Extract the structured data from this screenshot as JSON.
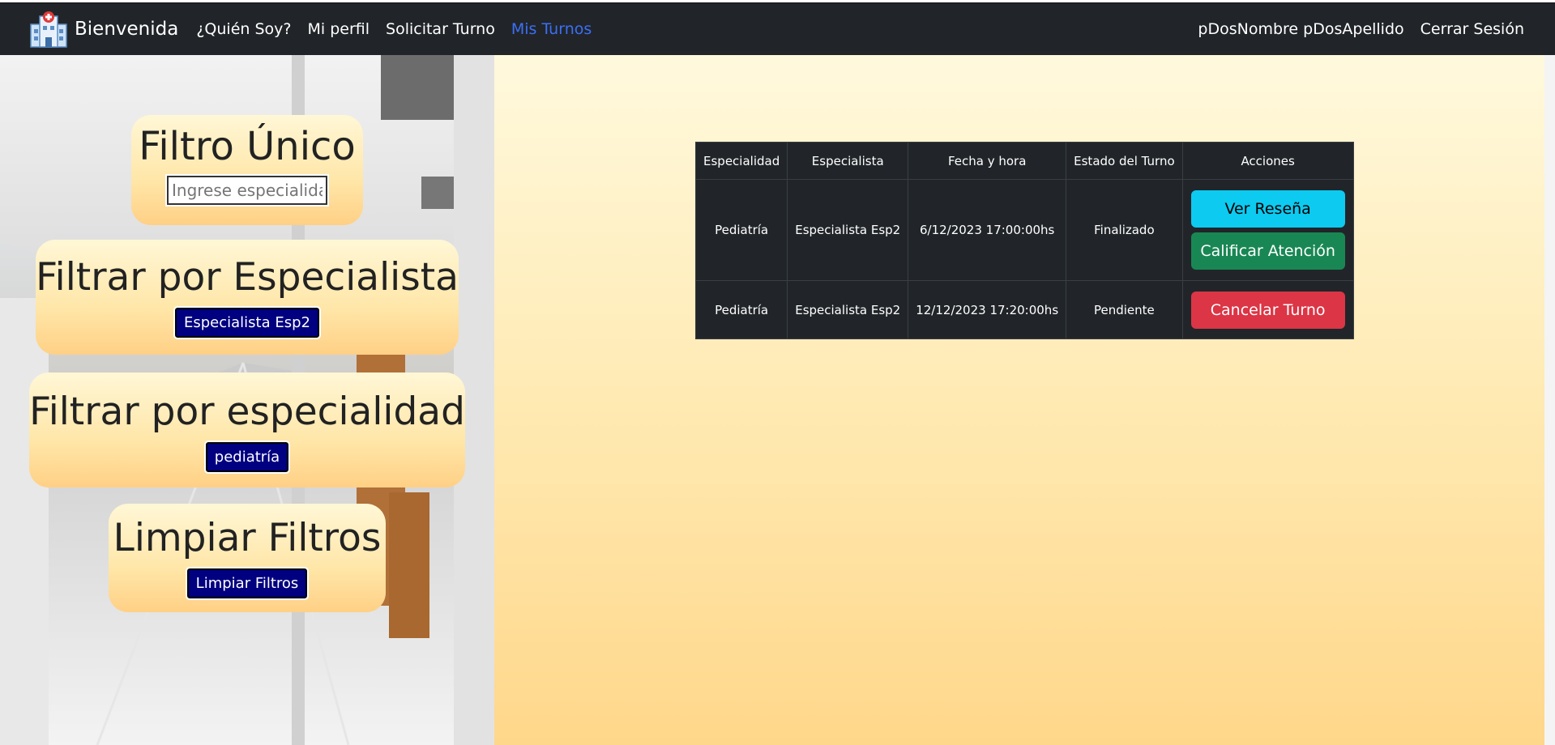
{
  "navbar": {
    "brand": "Bienvenida",
    "links": [
      "¿Quién Soy?",
      "Mi perfil",
      "Solicitar Turno",
      "Mis Turnos"
    ],
    "active_link": "Mis Turnos",
    "user_name": "pDosNombre pDosApellido",
    "logout": "Cerrar Sesión",
    "logo_icon": "hospital-icon"
  },
  "filters": {
    "unico": {
      "title": "Filtro Único",
      "placeholder": "Ingrese especialidad"
    },
    "especialista": {
      "title": "Filtrar por Especialista",
      "button": "Especialista Esp2"
    },
    "especialidad": {
      "title": "Filtrar por especialidad",
      "button": "pediatría"
    },
    "limpiar": {
      "title": "Limpiar Filtros",
      "button": "Limpiar Filtros"
    }
  },
  "table": {
    "headers": [
      "Especialidad",
      "Especialista",
      "Fecha y hora",
      "Estado del Turno",
      "Acciones"
    ],
    "rows": [
      {
        "especialidad": "Pediatría",
        "especialista": "Especialista Esp2",
        "fecha": "6/12/2023 17:00:00hs",
        "estado": "Finalizado",
        "actions": [
          "Ver Reseña",
          "Calificar Atención"
        ]
      },
      {
        "especialidad": "Pediatría",
        "especialista": "Especialista Esp2",
        "fecha": "12/12/2023 17:20:00hs",
        "estado": "Pendiente",
        "actions": [
          "Cancelar Turno"
        ]
      }
    ]
  },
  "colors": {
    "navbar_bg": "#212529",
    "active_link": "#3b6ff5",
    "filter_button": "#000080",
    "btn_info": "#0dcaf0",
    "btn_success": "#198754",
    "btn_danger": "#dc3545"
  }
}
